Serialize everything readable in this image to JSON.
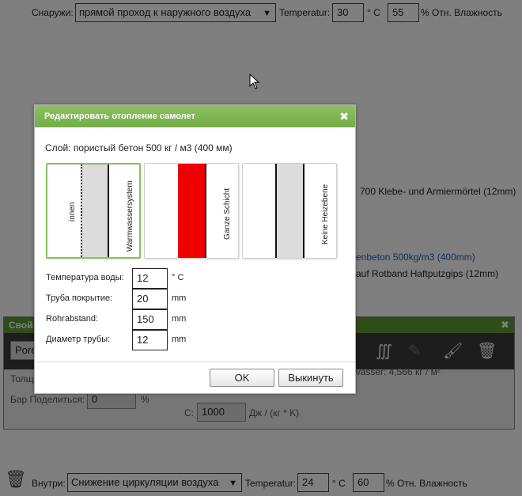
{
  "top_bar": {
    "outside_label": "Снаружи:",
    "outside_select": "прямой проход к наружного воздуха",
    "temperature_label": "Temperatur:",
    "temperature_value": "30",
    "temperature_unit": "° C",
    "humidity_value": "55",
    "humidity_unit": "% Отн. Влажность"
  },
  "background_layers": {
    "layer_a": "700 Klebe- und Armiermörtel (12mm)",
    "layer_b": "enbeton 500kg/m3 (400mm)",
    "layer_c": "auf Rotband Haftputzgips (12mm)"
  },
  "props_panel": {
    "title": "Свой",
    "material_value": "Pore",
    "thickness_label": "Толщ",
    "water_text": "wasser: 4,566 кг / м²",
    "bar_share_label": "Бар Поделиться:",
    "bar_share_value": "0",
    "bar_share_unit": "%",
    "c_label": "C:",
    "c_value": "1000",
    "c_unit": "Дж / (кг * K)"
  },
  "bottom_bar": {
    "inside_label": "Внутри:",
    "inside_select": "Снижение циркуляции воздуха",
    "temperature_label": "Temperatur:",
    "temperature_value": "24",
    "temperature_unit": "° C",
    "humidity_value": "60",
    "humidity_unit": "% Отн. Влажность"
  },
  "dialog": {
    "title": "Редактировать отопление самолет",
    "layer_caption": "Слой: пористый бетон 500 кг / м3 (400 мм)",
    "options": [
      {
        "left_label": "innen",
        "right_label": "Warmwassersystem"
      },
      {
        "right_label": "Ganze Schicht"
      },
      {
        "right_label": "Keine Heizebene"
      }
    ],
    "fields": [
      {
        "label": "Температура воды:",
        "value": "12",
        "unit": "° C"
      },
      {
        "label": "Труба покрытие:",
        "value": "20",
        "unit": "mm"
      },
      {
        "label": "Rohrabstand:",
        "value": "150",
        "unit": "mm"
      },
      {
        "label": "Диаметр трубы:",
        "value": "12",
        "unit": "mm"
      }
    ],
    "ok_label": "OK",
    "cancel_label": "Выкинуть"
  },
  "colors": {
    "accent_green": "#75ac48",
    "heating_red": "#ee0000"
  },
  "icons": [
    "cursor-icon",
    "close-icon",
    "heating-pipe-icon",
    "brush-off-icon",
    "brush-icon",
    "trash-icon"
  ]
}
